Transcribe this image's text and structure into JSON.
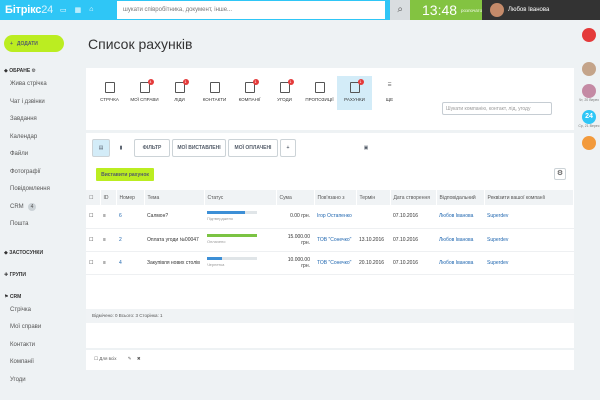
{
  "topbar": {
    "logo_main": "Бітрікс",
    "logo_num": "24",
    "search_placeholder": "шукати співробітника, документ, інше...",
    "time": "13:48",
    "status": "розпочато",
    "user_name": "Любов Іванова"
  },
  "sidebar": {
    "add_label": "ДОДАТИ",
    "section_fav": "ОБРАНЕ",
    "fav_items": [
      "Жива стрічка",
      "Чат і дзвінки",
      "Завдання",
      "Календар",
      "Файли",
      "Фотографії",
      "Повідомлення"
    ],
    "crm_label": "CRM",
    "crm_badge": "4",
    "mail_label": "Пошта",
    "section_apps": "ЗАСТОСУНКИ",
    "section_groups": "ГРУПИ",
    "section_crm": "CRM",
    "crm_items": [
      "Стрічка",
      "Мої справи",
      "Контакти",
      "Компанії",
      "Угоди"
    ]
  },
  "page": {
    "title": "Список рахунків"
  },
  "crm_tabs": [
    {
      "label": "СТРІЧКА",
      "count": ""
    },
    {
      "label": "МОЇ СПРАВИ",
      "count": "4"
    },
    {
      "label": "ЛІДИ",
      "count": "1"
    },
    {
      "label": "КОНТАКТИ",
      "count": ""
    },
    {
      "label": "КОМПАНІЇ",
      "count": "1"
    },
    {
      "label": "УГОДИ",
      "count": "1"
    },
    {
      "label": "ПРОПОЗИЦІЇ",
      "count": ""
    },
    {
      "label": "РАХУНКИ",
      "count": "1"
    },
    {
      "label": "ЩЕ",
      "count": ""
    }
  ],
  "crm_search_placeholder": "Шукати компанію, контакт, лід, угоду",
  "filters": {
    "filter": "ФІЛЬТР",
    "issued": "МОЇ ВИСТАВЛЕНІ",
    "paid": "МОЇ ОПЛАЧЕНІ",
    "add": "+"
  },
  "grid": {
    "create_label": "Виставити рахунок",
    "headers": [
      "",
      "ID",
      "Номер",
      "Тема",
      "Статус",
      "Сума",
      "Пов'язано з",
      "Термін",
      "Дата створення",
      "Відповідальний",
      "Реквізити вашої компанії"
    ],
    "rows": [
      {
        "num": "6",
        "topic": "Салмон?",
        "status": "Підтверджено",
        "progress": 0.75,
        "color": "blue",
        "sum": "0.00 грн.",
        "linked": "Ігор Остапенко",
        "due": "",
        "created": "07.10.2016",
        "resp": "Любов Іванова",
        "req": "Superdev"
      },
      {
        "num": "2",
        "topic": "Оплата угоди №00047",
        "status": "Оплачено",
        "progress": 1.0,
        "color": "green",
        "sum": "15.000.00 грн.",
        "linked": "ТОВ \"Сонечко\"",
        "due": "13.10.2016",
        "created": "07.10.2016",
        "resp": "Любов Іванова",
        "req": "Superdev"
      },
      {
        "num": "4",
        "topic": "Закупівля нових столів",
        "status": "Чернетка",
        "progress": 0.3,
        "color": "blue",
        "sum": "10.000.00 грн.",
        "linked": "ТОВ \"Сонечко\"",
        "due": "20.10.2016",
        "created": "07.10.2016",
        "resp": "Любов Іванова",
        "req": "Superdev"
      }
    ],
    "footer": "Відмічено: 0     Всього: 3     Сторінка: 1",
    "bottom": "Для всіх"
  },
  "rightbar": {
    "counter": "24",
    "l1": "Чт, 20 Верес",
    "l2": "Ср, 21 Верес"
  }
}
